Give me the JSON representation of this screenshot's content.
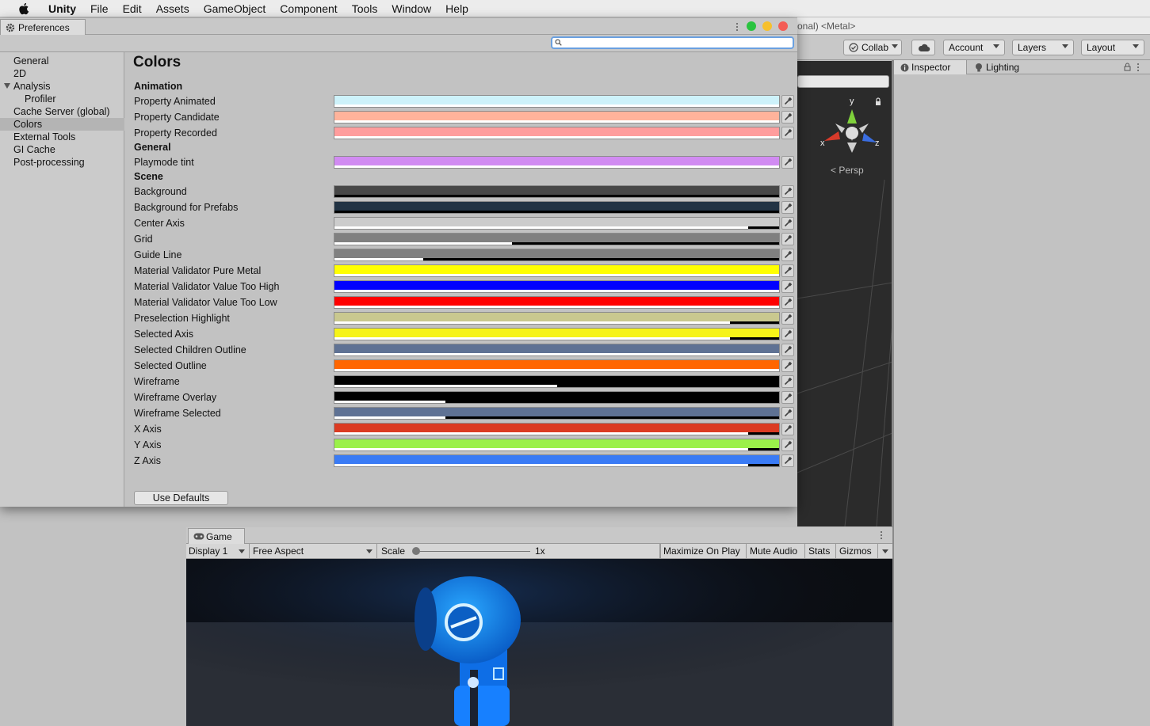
{
  "menubar": {
    "app": "Unity",
    "items": [
      "File",
      "Edit",
      "Assets",
      "GameObject",
      "Component",
      "Tools",
      "Window",
      "Help"
    ]
  },
  "editor": {
    "title_fragment": "onal) <Metal>",
    "collab_label": "Collab",
    "account_label": "Account",
    "layers_label": "Layers",
    "layout_label": "Layout",
    "inspector_tab": "Inspector",
    "lighting_tab": "Lighting",
    "gizmo": {
      "y": "y",
      "x": "x",
      "z": "z",
      "persp": "Persp"
    }
  },
  "game": {
    "tab_label": "Game",
    "display": "Display 1",
    "aspect": "Free Aspect",
    "scale_label": "Scale",
    "scale_value": "1x",
    "maximize": "Maximize On Play",
    "mute": "Mute Audio",
    "stats": "Stats",
    "gizmos": "Gizmos"
  },
  "prefs": {
    "tab_label": "Preferences",
    "search_value": "",
    "sidebar": [
      {
        "label": "General",
        "selected": false,
        "sub": false,
        "expander": false
      },
      {
        "label": "2D",
        "selected": false,
        "sub": false,
        "expander": false
      },
      {
        "label": "Analysis",
        "selected": false,
        "sub": false,
        "expander": true
      },
      {
        "label": "Profiler",
        "selected": false,
        "sub": true,
        "expander": false
      },
      {
        "label": "Cache Server (global)",
        "selected": false,
        "sub": false,
        "expander": false
      },
      {
        "label": "Colors",
        "selected": true,
        "sub": false,
        "expander": false
      },
      {
        "label": "External Tools",
        "selected": false,
        "sub": false,
        "expander": false
      },
      {
        "label": "GI Cache",
        "selected": false,
        "sub": false,
        "expander": false
      },
      {
        "label": "Post-processing",
        "selected": false,
        "sub": false,
        "expander": false
      }
    ],
    "title": "Colors",
    "sections": [
      {
        "name": "Animation",
        "rows": [
          {
            "label": "Property Animated",
            "color": "#cdf2fa",
            "alpha": 1.0
          },
          {
            "label": "Property Candidate",
            "color": "#ffb39b",
            "alpha": 1.0
          },
          {
            "label": "Property Recorded",
            "color": "#ff9d9d",
            "alpha": 1.0
          }
        ]
      },
      {
        "name": "General",
        "rows": [
          {
            "label": "Playmode tint",
            "color": "#d18bf2",
            "alpha": 1.0
          }
        ]
      },
      {
        "name": "Scene",
        "rows": [
          {
            "label": "Background",
            "color": "#474747",
            "alpha": 0.0
          },
          {
            "label": "Background for Prefabs",
            "color": "#223344",
            "alpha": 0.0
          },
          {
            "label": "Center Axis",
            "color": "#cccccc",
            "alpha": 0.93
          },
          {
            "label": "Grid",
            "color": "#808080",
            "alpha": 0.4
          },
          {
            "label": "Guide Line",
            "color": "#808080",
            "alpha": 0.2
          },
          {
            "label": "Material Validator Pure Metal",
            "color": "#ffff00",
            "alpha": 1.0
          },
          {
            "label": "Material Validator Value Too High",
            "color": "#0000ff",
            "alpha": 1.0
          },
          {
            "label": "Material Validator Value Too Low",
            "color": "#ff0000",
            "alpha": 1.0
          },
          {
            "label": "Preselection Highlight",
            "color": "#c9c88f",
            "alpha": 0.89
          },
          {
            "label": "Selected Axis",
            "color": "#f6f318",
            "alpha": 0.89
          },
          {
            "label": "Selected Children Outline",
            "color": "#5f7294",
            "alpha": 1.0
          },
          {
            "label": "Selected Outline",
            "color": "#ff6600",
            "alpha": 1.0
          },
          {
            "label": "Wireframe",
            "color": "#000000",
            "alpha": 0.5
          },
          {
            "label": "Wireframe Overlay",
            "color": "#000000",
            "alpha": 0.25
          },
          {
            "label": "Wireframe Selected",
            "color": "#5f7294",
            "alpha": 0.25
          },
          {
            "label": "X Axis",
            "color": "#db3b22",
            "alpha": 0.93
          },
          {
            "label": "Y Axis",
            "color": "#9bf04a",
            "alpha": 0.93
          },
          {
            "label": "Z Axis",
            "color": "#3a7bf5",
            "alpha": 0.93
          }
        ]
      }
    ],
    "use_defaults": "Use Defaults"
  },
  "colors": {
    "traffic_green": "#2ac33f",
    "traffic_yellow": "#f7c02d",
    "traffic_red": "#f45c55",
    "search_focus": "#6aa0e0"
  }
}
